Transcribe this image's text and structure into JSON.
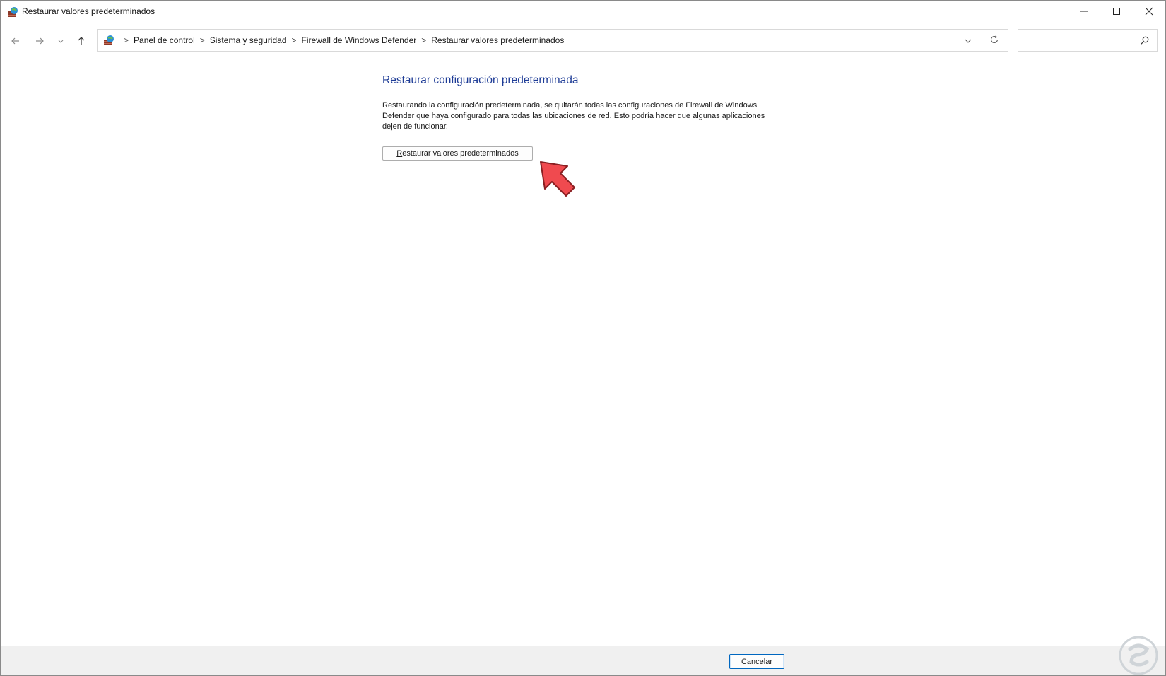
{
  "window": {
    "title": "Restaurar valores predeterminados",
    "minimize_icon": "minimize-icon",
    "maximize_icon": "maximize-icon",
    "close_icon": "close-icon"
  },
  "nav": {
    "back_icon": "arrow-left-icon",
    "forward_icon": "arrow-right-icon",
    "recent_icon": "chevron-down-icon",
    "up_icon": "arrow-up-icon"
  },
  "address": {
    "location_icon": "firewall-icon",
    "separator": ">",
    "crumbs": [
      "Panel de control",
      "Sistema y seguridad",
      "Firewall de Windows Defender",
      "Restaurar valores predeterminados"
    ]
  },
  "search": {
    "placeholder": "",
    "icon": "search-icon"
  },
  "main": {
    "title": "Restaurar configuración predeterminada",
    "description_lines": [
      "Restaurando la configuración predeterminada, se quitarán todas las configuraciones de Firewall de Windows",
      "Defender que haya configurado para todas las ubicaciones de red. Esto podría hacer que algunas aplicaciones",
      "dejen de funcionar."
    ],
    "restore_button": {
      "accel": "R",
      "rest": "estaurar valores predeterminados"
    }
  },
  "footer": {
    "cancel_label": "Cancelar"
  },
  "colors": {
    "title_blue": "#1e3c96",
    "accent": "#0067c0",
    "annotation_red": "#f04a4f"
  }
}
